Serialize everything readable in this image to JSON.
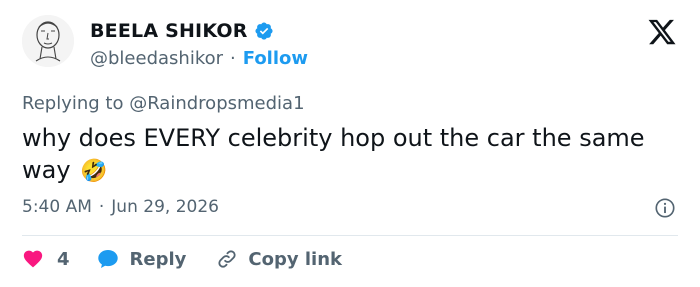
{
  "author": {
    "name": "BEELA SHIKOR",
    "handle": "@bleedashikor",
    "separator": "·",
    "follow_label": "Follow"
  },
  "replying": {
    "text": "Replying to @Raindropsmedia1"
  },
  "tweet": {
    "text": "why does EVERY celebrity hop out the car the same way",
    "emoji": "🤣"
  },
  "meta": {
    "time": "5:40 AM",
    "separator": "·",
    "date": "Jun 29, 2026"
  },
  "actions": {
    "likes": "4",
    "reply_label": "Reply",
    "copy_label": "Copy link"
  },
  "colors": {
    "accent": "#1d9bf0",
    "like": "#f91880",
    "muted": "#536471"
  },
  "icons": [
    "verified-badge-icon",
    "x-logo-icon",
    "info-icon",
    "heart-icon",
    "reply-bubble-icon",
    "link-icon"
  ]
}
